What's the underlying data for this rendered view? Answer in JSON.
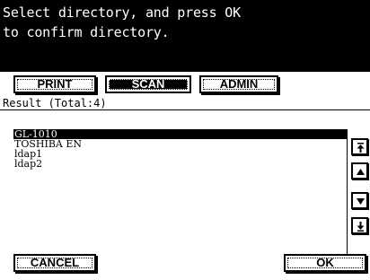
{
  "header": {
    "line1": "Select directory, and press OK",
    "line2": "to confirm directory."
  },
  "tabs": [
    {
      "label": "PRINT",
      "active": false
    },
    {
      "label": "SCAN",
      "active": true
    },
    {
      "label": "ADMIN",
      "active": false
    }
  ],
  "result_text": "Result (Total:4)",
  "directories": [
    {
      "name": "GL-1010",
      "selected": true
    },
    {
      "name": "TOSHIBA EN",
      "selected": false
    },
    {
      "name": "ldap1",
      "selected": false
    },
    {
      "name": "ldap2",
      "selected": false
    }
  ],
  "scroll_buttons": [
    "scroll-top-icon",
    "scroll-up-icon",
    "scroll-down-icon",
    "scroll-bottom-icon"
  ],
  "buttons": {
    "cancel_label": "CANCEL",
    "ok_label": "OK"
  }
}
